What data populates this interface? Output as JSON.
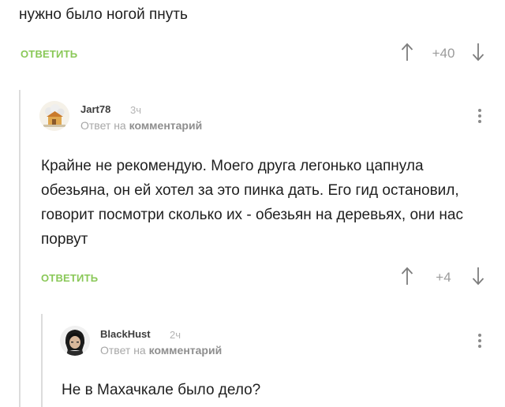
{
  "comments": [
    {
      "text": "нужно было ногой пнуть",
      "reply_label": "ОТВЕТИТЬ",
      "rating": "+40"
    },
    {
      "username": "Jart78",
      "time": "3ч",
      "reply_to_prefix": "Ответ на",
      "reply_to_link": "комментарий",
      "text": "Крайне не рекомендую. Моего друга легонько цапнула обезьяна, он ей хотел за это пинка дать. Его гид остановил, говорит посмотри сколько их - обезьян на деревьях, они нас порвут",
      "reply_label": "ОТВЕТИТЬ",
      "rating": "+4"
    },
    {
      "username": "BlackHust",
      "time": "2ч",
      "reply_to_prefix": "Ответ на",
      "reply_to_link": "комментарий",
      "text": "Не в Махачкале было дело?"
    }
  ],
  "colors": {
    "accent_green": "#8ac858",
    "thread_line": "#dcdcdc",
    "muted_text": "#a7a7a7"
  },
  "icons": {
    "upvote": "arrow-up-icon",
    "downvote": "arrow-down-icon",
    "menu": "kebab-menu-icon"
  }
}
